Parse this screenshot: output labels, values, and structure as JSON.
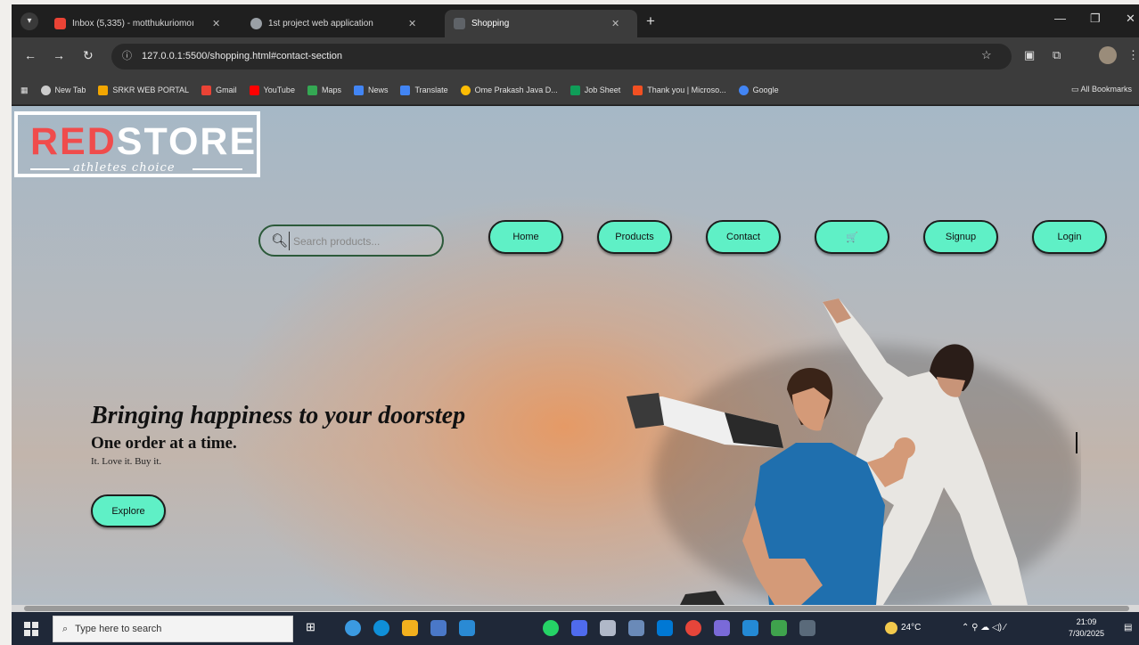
{
  "browser": {
    "tabs": [
      {
        "title": "Inbox (5,335) - motthukuriomoı",
        "icon": "gmail-icon",
        "color": "#ea4335",
        "active": false
      },
      {
        "title": "1st project web application",
        "icon": "globe-icon",
        "color": "#9aa0a6",
        "active": false
      },
      {
        "title": "Shopping",
        "icon": "page-icon",
        "color": "#5f6368",
        "active": true
      }
    ],
    "url": "127.0.0.1:5500/shopping.html#contact-section",
    "bookmarks": [
      {
        "label": "New Tab",
        "color": "#cccccc"
      },
      {
        "label": "SRKR WEB PORTAL",
        "color": "#f2a600"
      },
      {
        "label": "Gmail",
        "color": "#ea4335"
      },
      {
        "label": "YouTube",
        "color": "#ff0000"
      },
      {
        "label": "Maps",
        "color": "#34a853"
      },
      {
        "label": "News",
        "color": "#4285f4"
      },
      {
        "label": "Translate",
        "color": "#4285f4"
      },
      {
        "label": "Ome Prakash Java D...",
        "color": "#fbbc04"
      },
      {
        "label": "Job Sheet",
        "color": "#0f9d58"
      },
      {
        "label": "Thank you | Microso...",
        "color": "#f25022"
      },
      {
        "label": "Google",
        "color": "#4285f4"
      }
    ],
    "all_bookmarks": "All Bookmarks"
  },
  "page": {
    "logo": {
      "red": "RED",
      "white": "STORE",
      "tagline": "athletes choice"
    },
    "search": {
      "placeholder": "Search products..."
    },
    "nav": [
      "Home",
      "Products",
      "Contact",
      "🛒",
      "Signup",
      "Login"
    ],
    "hero": {
      "title": "Bringing happiness to your doorstep",
      "subtitle": "One order at a time.",
      "small": "It. Love it. Buy it.",
      "cta": "Explore"
    },
    "accent_color": "#5ff0c6"
  },
  "taskbar": {
    "search_placeholder": "Type here to search",
    "weather": "24°C",
    "time": "21:09",
    "date": "7/30/2025"
  }
}
